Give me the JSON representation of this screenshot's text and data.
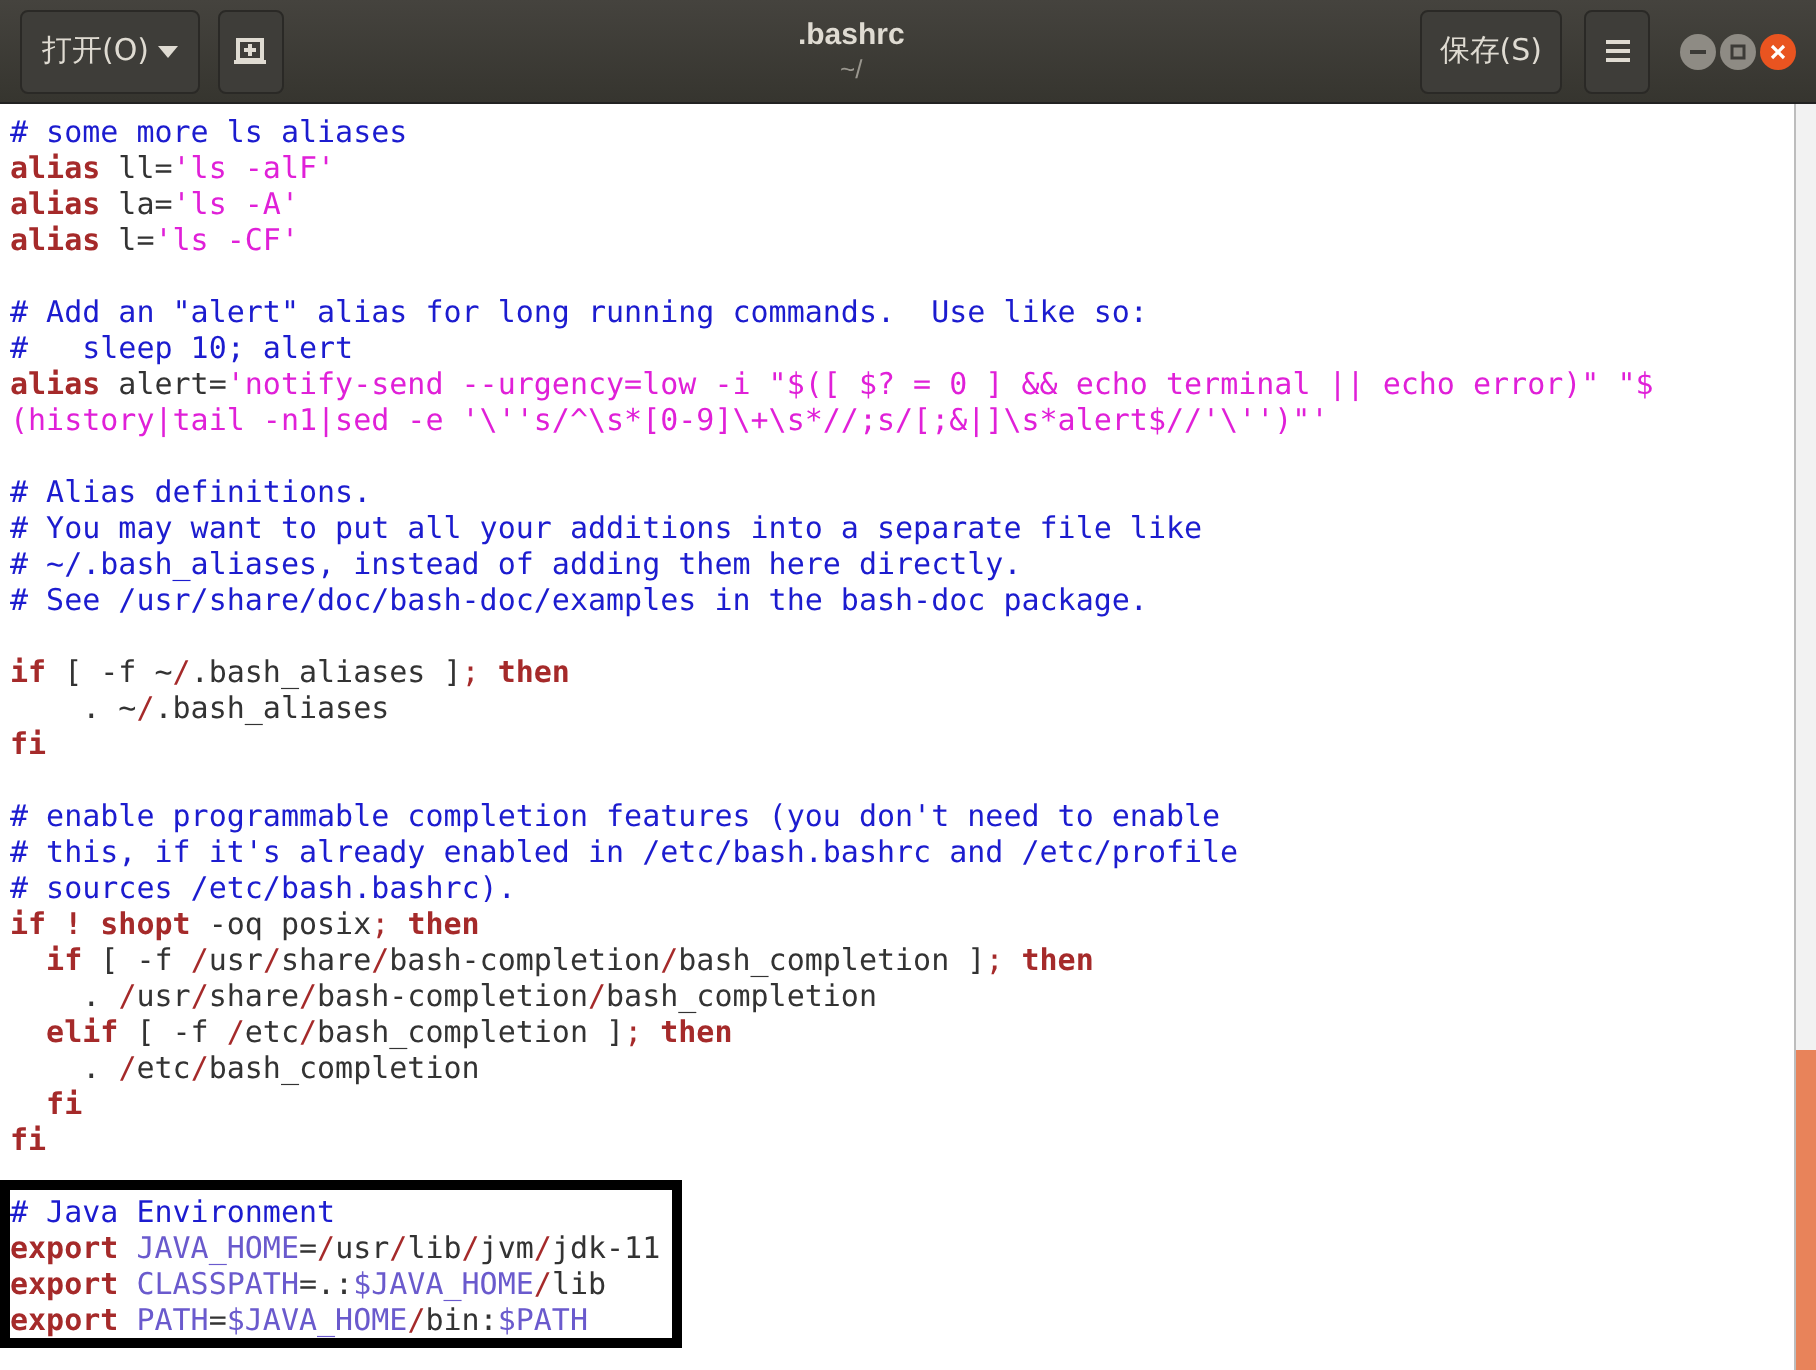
{
  "window": {
    "title": ".bashrc",
    "subtitle": "~/"
  },
  "header_bar": {
    "open_button": {
      "label": "打开(O)"
    },
    "save_button": {
      "label": "保存(S)"
    }
  },
  "editor": {
    "lines": [
      {
        "kind": "code",
        "tokens": [
          {
            "text": "# some more ls aliases",
            "kind": "comment"
          }
        ]
      },
      {
        "kind": "code",
        "tokens": [
          {
            "text": "alias",
            "kind": "keyword"
          },
          {
            "text": " ll=",
            "kind": "plain"
          },
          {
            "text": "'ls -alF'",
            "kind": "string"
          }
        ]
      },
      {
        "kind": "code",
        "tokens": [
          {
            "text": "alias",
            "kind": "keyword"
          },
          {
            "text": " la=",
            "kind": "plain"
          },
          {
            "text": "'ls -A'",
            "kind": "string"
          }
        ]
      },
      {
        "kind": "code",
        "tokens": [
          {
            "text": "alias",
            "kind": "keyword"
          },
          {
            "text": " l=",
            "kind": "plain"
          },
          {
            "text": "'ls -CF'",
            "kind": "string"
          }
        ]
      },
      {
        "kind": "blank"
      },
      {
        "kind": "code",
        "tokens": [
          {
            "text": "# Add an \"alert\" alias for long running commands.  Use like so:",
            "kind": "comment"
          }
        ]
      },
      {
        "kind": "code",
        "tokens": [
          {
            "text": "#   sleep 10; alert",
            "kind": "comment"
          }
        ]
      },
      {
        "kind": "code",
        "tokens": [
          {
            "text": "alias",
            "kind": "keyword"
          },
          {
            "text": " alert=",
            "kind": "plain"
          },
          {
            "text": "'notify-send --urgency=low -i \"$([ $? = 0 ] && echo terminal || echo error)\" \"$",
            "kind": "string"
          }
        ]
      },
      {
        "kind": "code",
        "tokens": [
          {
            "text": "(history|tail -n1|sed -e '\\''s/^\\s*[0-9]\\+\\s*//;s/[;&|]\\s*alert$//'\\'')\"'",
            "kind": "string"
          }
        ]
      },
      {
        "kind": "blank"
      },
      {
        "kind": "code",
        "tokens": [
          {
            "text": "# Alias definitions.",
            "kind": "comment"
          }
        ]
      },
      {
        "kind": "code",
        "tokens": [
          {
            "text": "# You may want to put all your additions into a separate file like",
            "kind": "comment"
          }
        ]
      },
      {
        "kind": "code",
        "tokens": [
          {
            "text": "# ~/.bash_aliases, instead of adding them here directly.",
            "kind": "comment"
          }
        ]
      },
      {
        "kind": "code",
        "tokens": [
          {
            "text": "# See /usr/share/doc/bash-doc/examples in the bash-doc package.",
            "kind": "comment"
          }
        ]
      },
      {
        "kind": "blank"
      },
      {
        "kind": "code",
        "tokens": [
          {
            "text": "if",
            "kind": "keyword"
          },
          {
            "text": " [ -f ~",
            "kind": "plain"
          },
          {
            "text": "/",
            "kind": "operator"
          },
          {
            "text": ".bash_aliases ]",
            "kind": "plain"
          },
          {
            "text": "; ",
            "kind": "operator"
          },
          {
            "text": "then",
            "kind": "keyword"
          }
        ]
      },
      {
        "kind": "code",
        "tokens": [
          {
            "text": "    . ~",
            "kind": "plain"
          },
          {
            "text": "/",
            "kind": "operator"
          },
          {
            "text": ".bash_aliases",
            "kind": "plain"
          }
        ]
      },
      {
        "kind": "code",
        "tokens": [
          {
            "text": "fi",
            "kind": "keyword"
          }
        ]
      },
      {
        "kind": "blank"
      },
      {
        "kind": "code",
        "tokens": [
          {
            "text": "# enable programmable completion features (you don't need to enable",
            "kind": "comment"
          }
        ]
      },
      {
        "kind": "code",
        "tokens": [
          {
            "text": "# this, if it's already enabled in /etc/bash.bashrc and /etc/profile",
            "kind": "comment"
          }
        ]
      },
      {
        "kind": "code",
        "tokens": [
          {
            "text": "# sources /etc/bash.bashrc).",
            "kind": "comment"
          }
        ]
      },
      {
        "kind": "code",
        "tokens": [
          {
            "text": "if ! shopt",
            "kind": "keyword"
          },
          {
            "text": " -oq posix",
            "kind": "plain"
          },
          {
            "text": "; ",
            "kind": "operator"
          },
          {
            "text": "then",
            "kind": "keyword"
          }
        ]
      },
      {
        "kind": "code",
        "tokens": [
          {
            "text": "  if",
            "kind": "keyword"
          },
          {
            "text": " [ -f ",
            "kind": "plain"
          },
          {
            "text": "/",
            "kind": "operator"
          },
          {
            "text": "usr",
            "kind": "plain"
          },
          {
            "text": "/",
            "kind": "operator"
          },
          {
            "text": "share",
            "kind": "plain"
          },
          {
            "text": "/",
            "kind": "operator"
          },
          {
            "text": "bash-completion",
            "kind": "plain"
          },
          {
            "text": "/",
            "kind": "operator"
          },
          {
            "text": "bash_completion ]",
            "kind": "plain"
          },
          {
            "text": "; ",
            "kind": "operator"
          },
          {
            "text": "then",
            "kind": "keyword"
          }
        ]
      },
      {
        "kind": "code",
        "tokens": [
          {
            "text": "    . ",
            "kind": "plain"
          },
          {
            "text": "/",
            "kind": "operator"
          },
          {
            "text": "usr",
            "kind": "plain"
          },
          {
            "text": "/",
            "kind": "operator"
          },
          {
            "text": "share",
            "kind": "plain"
          },
          {
            "text": "/",
            "kind": "operator"
          },
          {
            "text": "bash-completion",
            "kind": "plain"
          },
          {
            "text": "/",
            "kind": "operator"
          },
          {
            "text": "bash_completion",
            "kind": "plain"
          }
        ]
      },
      {
        "kind": "code",
        "tokens": [
          {
            "text": "  elif",
            "kind": "keyword"
          },
          {
            "text": " [ -f ",
            "kind": "plain"
          },
          {
            "text": "/",
            "kind": "operator"
          },
          {
            "text": "etc",
            "kind": "plain"
          },
          {
            "text": "/",
            "kind": "operator"
          },
          {
            "text": "bash_completion ]",
            "kind": "plain"
          },
          {
            "text": "; ",
            "kind": "operator"
          },
          {
            "text": "then",
            "kind": "keyword"
          }
        ]
      },
      {
        "kind": "code",
        "tokens": [
          {
            "text": "    . ",
            "kind": "plain"
          },
          {
            "text": "/",
            "kind": "operator"
          },
          {
            "text": "etc",
            "kind": "plain"
          },
          {
            "text": "/",
            "kind": "operator"
          },
          {
            "text": "bash_completion",
            "kind": "plain"
          }
        ]
      },
      {
        "kind": "code",
        "tokens": [
          {
            "text": "  fi",
            "kind": "keyword"
          }
        ]
      },
      {
        "kind": "code",
        "tokens": [
          {
            "text": "fi",
            "kind": "keyword"
          }
        ]
      },
      {
        "kind": "blank"
      }
    ],
    "highlight_box": {
      "lines": [
        {
          "kind": "code",
          "tokens": [
            {
              "text": "# Java Environment",
              "kind": "comment"
            }
          ]
        },
        {
          "kind": "code",
          "tokens": [
            {
              "text": "export",
              "kind": "keyword"
            },
            {
              "text": " JAVA_HOME",
              "kind": "variable"
            },
            {
              "text": "=",
              "kind": "plain"
            },
            {
              "text": "/",
              "kind": "operator"
            },
            {
              "text": "usr",
              "kind": "plain"
            },
            {
              "text": "/",
              "kind": "operator"
            },
            {
              "text": "lib",
              "kind": "plain"
            },
            {
              "text": "/",
              "kind": "operator"
            },
            {
              "text": "jvm",
              "kind": "plain"
            },
            {
              "text": "/",
              "kind": "operator"
            },
            {
              "text": "jdk-11",
              "kind": "plain"
            }
          ]
        },
        {
          "kind": "code",
          "tokens": [
            {
              "text": "export",
              "kind": "keyword"
            },
            {
              "text": " CLASSPATH",
              "kind": "variable"
            },
            {
              "text": "=.:",
              "kind": "plain"
            },
            {
              "text": "$JAVA_HOME",
              "kind": "variable"
            },
            {
              "text": "/",
              "kind": "operator"
            },
            {
              "text": "lib",
              "kind": "plain"
            }
          ]
        },
        {
          "kind": "code",
          "tokens": [
            {
              "text": "export",
              "kind": "keyword"
            },
            {
              "text": " PATH",
              "kind": "variable"
            },
            {
              "text": "=",
              "kind": "plain"
            },
            {
              "text": "$JAVA_HOME",
              "kind": "variable"
            },
            {
              "text": "/",
              "kind": "operator"
            },
            {
              "text": "bin:",
              "kind": "plain"
            },
            {
              "text": "$PATH",
              "kind": "variable"
            }
          ]
        }
      ]
    }
  }
}
